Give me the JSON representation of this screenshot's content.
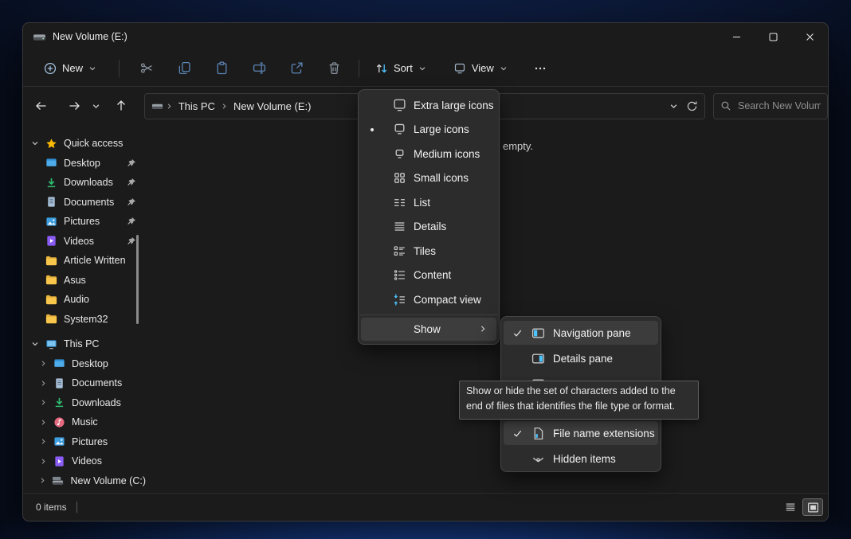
{
  "window": {
    "title": "New Volume (E:)"
  },
  "toolbar": {
    "new": "New",
    "sort": "Sort",
    "view": "View"
  },
  "address": {
    "crumbs": [
      "This PC",
      "New Volume (E:)"
    ],
    "search_placeholder": "Search New Volum..."
  },
  "sidebar": {
    "quick_access": {
      "label": "Quick access",
      "items": [
        {
          "label": "Desktop",
          "pinned": true
        },
        {
          "label": "Downloads",
          "pinned": true
        },
        {
          "label": "Documents",
          "pinned": true
        },
        {
          "label": "Pictures",
          "pinned": true
        },
        {
          "label": "Videos",
          "pinned": true
        },
        {
          "label": "Article Written",
          "pinned": false
        },
        {
          "label": "Asus",
          "pinned": false
        },
        {
          "label": "Audio",
          "pinned": false
        },
        {
          "label": "System32",
          "pinned": false
        }
      ]
    },
    "this_pc": {
      "label": "This PC",
      "items": [
        {
          "label": "Desktop"
        },
        {
          "label": "Documents"
        },
        {
          "label": "Downloads"
        },
        {
          "label": "Music"
        },
        {
          "label": "Pictures"
        },
        {
          "label": "Videos"
        },
        {
          "label": "New Volume (C:)"
        }
      ]
    }
  },
  "content": {
    "empty_text": "empty."
  },
  "view_menu": {
    "items": [
      {
        "label": "Extra large icons",
        "selected": false
      },
      {
        "label": "Large icons",
        "selected": true
      },
      {
        "label": "Medium icons",
        "selected": false
      },
      {
        "label": "Small icons",
        "selected": false
      },
      {
        "label": "List",
        "selected": false
      },
      {
        "label": "Details",
        "selected": false
      },
      {
        "label": "Tiles",
        "selected": false
      },
      {
        "label": "Content",
        "selected": false
      },
      {
        "label": "Compact view",
        "selected": false
      }
    ],
    "show": {
      "label": "Show",
      "has_submenu": true
    }
  },
  "show_submenu": {
    "items": [
      {
        "label": "Navigation pane",
        "checked": true
      },
      {
        "label": "Details pane",
        "checked": false
      },
      {
        "label": "File name extensions",
        "checked": true
      },
      {
        "label": "Hidden items",
        "checked": false
      }
    ]
  },
  "tooltip": {
    "text": "Show or hide the set of characters added to the end of files that identifies the file type or format."
  },
  "statusbar": {
    "count": "0 items"
  },
  "colors": {
    "accent": "#4cc2ff",
    "folder": "#f7c64b",
    "star": "#f8b900",
    "downloads_green": "#2fbf71",
    "videos_purple": "#8a5cf5",
    "music_pink": "#e4687e"
  },
  "icons": {
    "titlebar": [
      "drive-icon",
      "minimize-icon",
      "maximize-icon",
      "close-icon"
    ],
    "toolbar": [
      "new-plus-icon",
      "cut-icon",
      "copy-icon",
      "paste-icon",
      "rename-icon",
      "share-icon",
      "delete-icon",
      "sort-icon",
      "view-icon",
      "more-icon"
    ],
    "address": [
      "back-arrow-icon",
      "forward-arrow-icon",
      "history-chevron-icon",
      "up-arrow-icon",
      "drive-icon",
      "refresh-icon",
      "search-icon"
    ],
    "view_menu": [
      "extra-large-icon",
      "large-icon",
      "medium-icon",
      "small-icons-icon",
      "list-icon",
      "details-icon",
      "tiles-icon",
      "content-icon",
      "compact-view-icon"
    ],
    "show_submenu": [
      "navigation-pane-icon",
      "details-pane-icon",
      "preview-pane-icon",
      "file-extensions-icon",
      "hidden-items-eye-icon"
    ],
    "statusbar": [
      "details-view-icon",
      "thumbnail-view-icon"
    ]
  }
}
